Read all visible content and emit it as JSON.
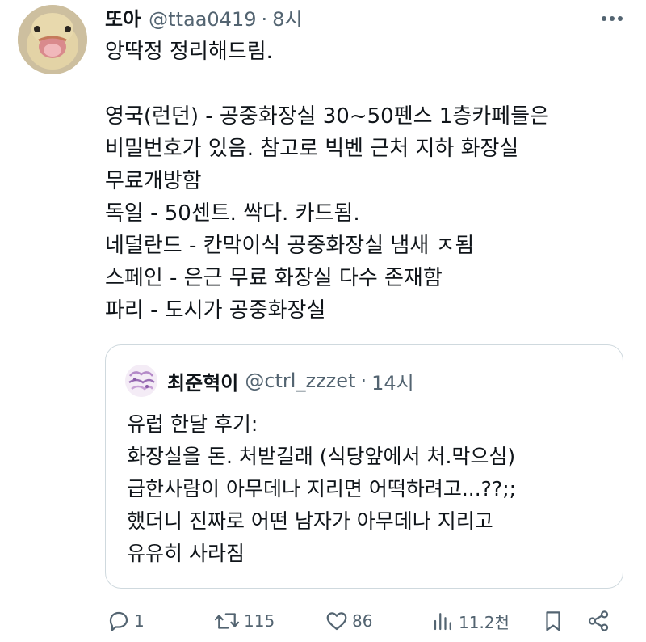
{
  "tweet": {
    "display_name": "또아",
    "handle": "@ttaa0419",
    "separator": "·",
    "time": "8시",
    "lines": [
      "앙딱정 정리해드림.",
      "",
      "영국(런던) - 공중화장실 30~50펜스 1층카페들은",
      "비밀번호가 있음. 참고로 빅벤 근처 지하 화장실",
      "무료개방함",
      "독일 - 50센트. 싹다. 카드됨.",
      "네덜란드 - 칸막이식 공중화장실 냄새 ㅈ됨",
      "스페인 - 은근 무료 화장실 다수 존재함",
      "파리 - 도시가 공중화장실"
    ]
  },
  "quote": {
    "display_name": "최준혁이",
    "handle": "@ctrl_zzzet",
    "separator": "·",
    "time": "14시",
    "lines": [
      "유럽 한달 후기:",
      "화장실을 돈. 처받길래 (식당앞에서 처.막으심)",
      "급한사람이 아무데나 지리면 어떡하려고...??;;",
      "했더니 진짜로 어떤 남자가 아무데나 지리고",
      "유유히 사라짐"
    ]
  },
  "actions": {
    "reply_count": "1",
    "retweet_count": "115",
    "like_count": "86",
    "view_count": "11.2천"
  },
  "icons": {
    "reply": "reply-icon",
    "retweet": "retweet-icon",
    "like": "heart-icon",
    "views": "views-icon",
    "bookmark": "bookmark-icon",
    "share": "share-icon",
    "more": "more-icon"
  },
  "colors": {
    "text": "#0f1419",
    "secondary": "#536471",
    "border": "#cfd9de"
  }
}
